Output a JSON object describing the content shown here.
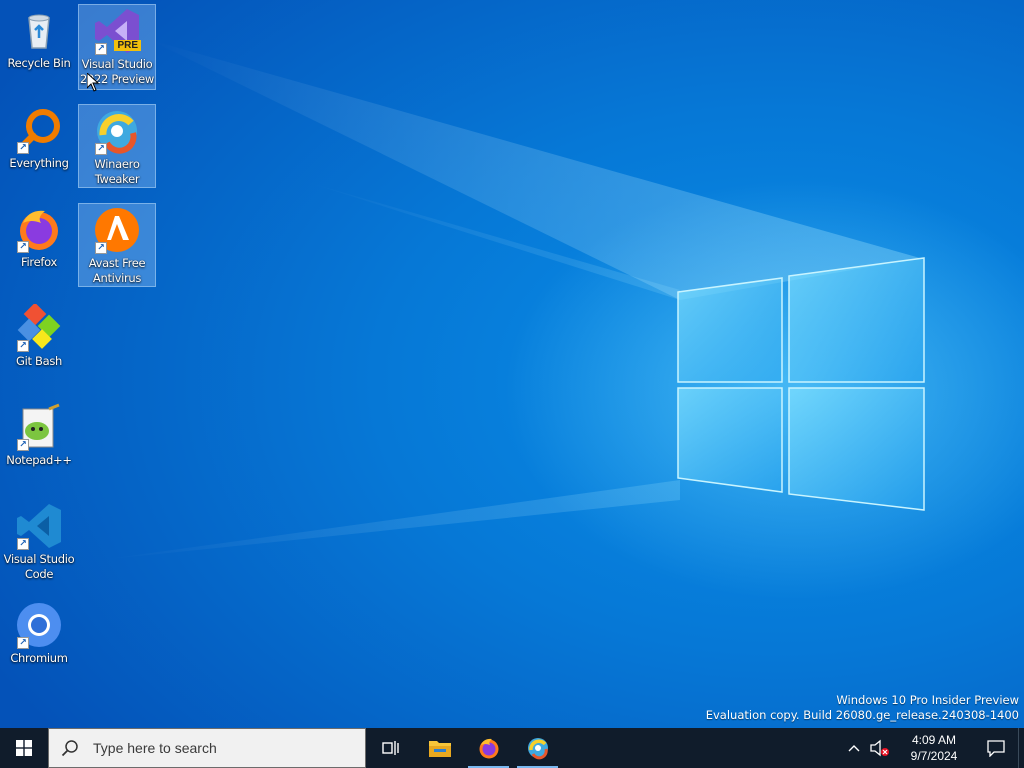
{
  "desktop": {
    "icons": [
      {
        "label": "Recycle Bin",
        "icon": "recycle-bin-icon",
        "shortcut": false
      },
      {
        "label": "Visual Studio 2022 Preview",
        "icon": "visual-studio-preview-icon",
        "shortcut": true,
        "badge": "PRE"
      },
      {
        "label": "Everything",
        "icon": "everything-search-icon",
        "shortcut": true
      },
      {
        "label": "Winaero Tweaker",
        "icon": "winaero-tweaker-icon",
        "shortcut": true
      },
      {
        "label": "Firefox",
        "icon": "firefox-icon",
        "shortcut": true
      },
      {
        "label": "Avast Free Antivirus",
        "icon": "avast-icon",
        "shortcut": true
      },
      {
        "label": "Git Bash",
        "icon": "git-bash-icon",
        "shortcut": true
      },
      {
        "label": "Notepad++",
        "icon": "notepad-plus-plus-icon",
        "shortcut": true
      },
      {
        "label": "Visual Studio Code",
        "icon": "vscode-icon",
        "shortcut": true
      },
      {
        "label": "Chromium",
        "icon": "chromium-icon",
        "shortcut": true
      }
    ],
    "watermark": {
      "line1": "Windows 10 Pro Insider Preview",
      "line2": "Evaluation copy. Build 26080.ge_release.240308-1400"
    }
  },
  "taskbar": {
    "search_placeholder": "Type here to search",
    "pinned": [
      {
        "icon": "task-view-icon",
        "active": false
      },
      {
        "icon": "file-explorer-icon",
        "active": false
      },
      {
        "icon": "firefox-icon",
        "active": true
      },
      {
        "icon": "winaero-tweaker-icon",
        "active": true
      }
    ],
    "tray": {
      "time": "4:09 AM",
      "date": "9/7/2024"
    }
  },
  "colors": {
    "desktop_blue": "#0678d6",
    "taskbar": "#101c2b",
    "accent": "#7ab8f0"
  }
}
